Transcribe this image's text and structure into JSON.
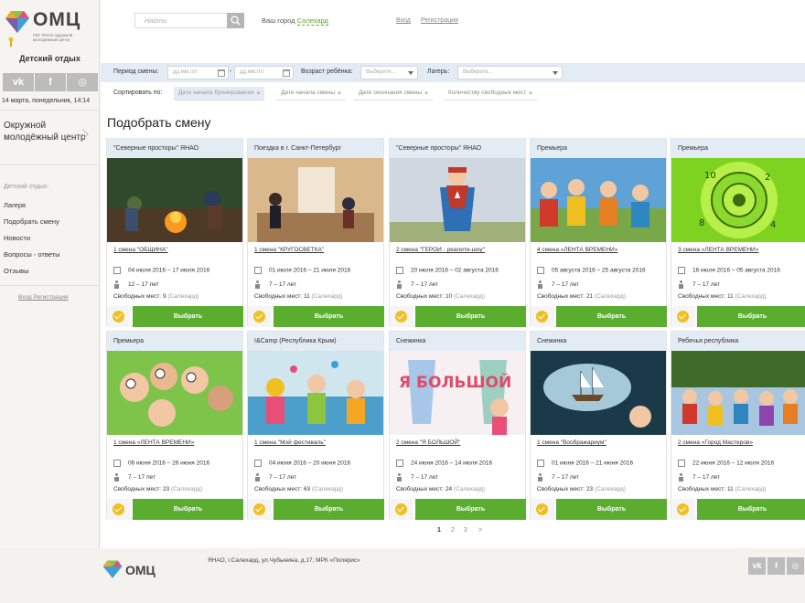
{
  "sidebar": {
    "logo_text": "ОМЦ",
    "logo_sub": "ГБУ ЯНАО окружной молодёжный центр",
    "section_title": "Детский отдых",
    "social": [
      "vk-icon",
      "facebook-icon",
      "instagram-icon"
    ],
    "date": "14 марта, понедельник, 14:14",
    "org_link": "Окружной молодёжный центр",
    "nav_heading": "Детский отдых:",
    "nav": [
      "Лагеря",
      "Подобрать смену",
      "Новости",
      "Вопросы - ответы",
      "Отзывы"
    ],
    "login": "Вход",
    "register": "Регистрация"
  },
  "header": {
    "search_placeholder": "Найти",
    "city_label": "Ваш город",
    "city": "Салехард",
    "login": "Вход",
    "register": "Регистрация"
  },
  "filters": {
    "period_label": "Период смены:",
    "date_placeholder": "дд.мм.гггг",
    "dash": "-",
    "age_label": "Возраст ребёнка:",
    "age_placeholder": "Выберите...",
    "camp_label": "Лагерь:",
    "camp_placeholder": "Выберите..."
  },
  "sort": {
    "label": "Сортировать по:",
    "options": [
      "Дате начала бронирования",
      "Дате начала смены",
      "Дате окончания смены",
      "Количеству свободных мест"
    ]
  },
  "page_title": "Подобрать смену",
  "button_label": "Выбрать",
  "free_label": "Свободных мест:",
  "cards": [
    {
      "camp": "\"Северные просторы\" ЯНАО",
      "name": "1 смена \"ОБЩИНА\"",
      "dates": "04 июля 2016 – 17 июля 2016",
      "age": "12 – 17 лет",
      "free": "9",
      "city": "(Салехард)"
    },
    {
      "camp": "Поездка в г. Санкт-Петербург",
      "name": "1 смена \"КРУГОСВЕТКА\"",
      "dates": "01 июля 2016 – 21 июля 2016",
      "age": "7 – 17 лет",
      "free": "11",
      "city": "(Салехард)"
    },
    {
      "camp": "\"Северные просторы\" ЯНАО",
      "name": "2 смена \"ГЕРОИ - реалити-шоу\"",
      "dates": "20 июля 2016 – 02 августа 2016",
      "age": "7 – 17 лет",
      "free": "10",
      "city": "(Салехард)"
    },
    {
      "camp": "Премьера",
      "name": "4 смена «ЛЕНТА ВРЕМЕНИ»",
      "dates": "05 августа 2016 – 25 августа 2016",
      "age": "7 – 17 лет",
      "free": "21",
      "city": "(Салехард)"
    },
    {
      "camp": "Премьера",
      "name": "3 смена «ЛЕНТА ВРЕМЕНИ»",
      "dates": "16 июля 2016 – 05 августа 2016",
      "age": "7 – 17 лет",
      "free": "11",
      "city": "(Салехард)"
    },
    {
      "camp": "Премьера",
      "name": "1 смена «ЛЕНТА ВРЕМЕНИ»",
      "dates": "06 июня 2016 – 26 июня 2016",
      "age": "7 – 17 лет",
      "free": "23",
      "city": "(Салехард)"
    },
    {
      "camp": "I&Camp (Республика Крым)",
      "name": "1 смена \"Мой фестиваль\"",
      "dates": "04 июня 2016 – 20 июня 2016",
      "age": "7 – 17 лет",
      "free": "63",
      "city": "(Салехард)"
    },
    {
      "camp": "Снежинка",
      "name": "2 смена \"Я БОЛЬШОЙ\"",
      "dates": "24 июня 2016 – 14 июля 2016",
      "age": "7 – 17 лет",
      "free": "24",
      "city": "(Салехард)"
    },
    {
      "camp": "Снежинка",
      "name": "1 смена \"Воображариум\"",
      "dates": "01 июня 2016 – 21 июня 2016",
      "age": "7 – 17 лет",
      "free": "23",
      "city": "(Салехард)"
    },
    {
      "camp": "Ребячья республика",
      "name": "2 смена «Город Мастеров»",
      "dates": "22 июня 2016 – 12 июля 2016",
      "age": "7 – 17 лет",
      "free": "11",
      "city": "(Салехард)"
    }
  ],
  "pagination": [
    "1",
    "2",
    "3",
    ">"
  ],
  "footer": {
    "address": "ЯНАО, г.Салехард, ул.Чубынина, д.17, МРК «Полярис»",
    "logo_text": "ОМЦ"
  },
  "colors": {
    "accent_green": "#5aad2f",
    "filter_blue": "#e3ecf4",
    "check_yellow": "#f0c020"
  }
}
